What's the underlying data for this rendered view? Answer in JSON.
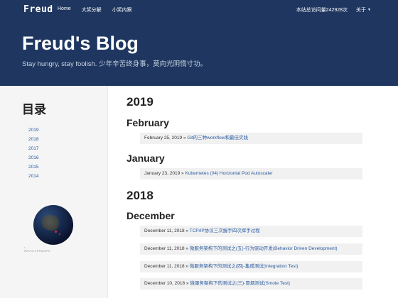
{
  "navbar": {
    "brand": "Freud",
    "links": [
      "Home",
      "大奖分解",
      "小奖内察"
    ],
    "visits": "本站总访问量242928次",
    "about": "关于"
  },
  "hero": {
    "title": "Freud's Blog",
    "subtitle": "Stay hungry, stay foolish. 少年辛苦终身事，莫向光阴惰寸功。"
  },
  "sidebar": {
    "title": "目录",
    "years": [
      "2019",
      "2018",
      "2017",
      "2016",
      "2015",
      "2014"
    ],
    "globe_caption_1": "• ...",
    "globe_caption_2": "REVOLVERMAPS"
  },
  "archive": {
    "y2019": "2019",
    "feb": "February",
    "feb_posts": [
      {
        "date": "February 25, 2019",
        "title": "Git的三种workflow和最佳实践"
      }
    ],
    "jan": "January",
    "jan_posts": [
      {
        "date": "January 23, 2019",
        "title": "Kubernetes (04) Horizontal Pod Autoscaler"
      }
    ],
    "y2018": "2018",
    "dec": "December",
    "dec_posts": [
      {
        "date": "December 11, 2018",
        "title": "TCP/IP协议三次握手四次挥手过程"
      },
      {
        "date": "December 11, 2018",
        "title": "微服务架构下的测试之(五)-行为驱动开发(Behavior Driven Development)"
      },
      {
        "date": "December 11, 2018",
        "title": "微服务架构下的测试之(四)-集成测试(Integration Test)"
      },
      {
        "date": "December 10, 2018",
        "title": "微服务架构下的测试之(三)-冒烟测试(Smote Test)"
      }
    ],
    "separator": "»"
  },
  "colors": {
    "navbar_bg": "#1f3760",
    "link": "#2a5a9e",
    "post_bg": "#f1f1f1"
  }
}
